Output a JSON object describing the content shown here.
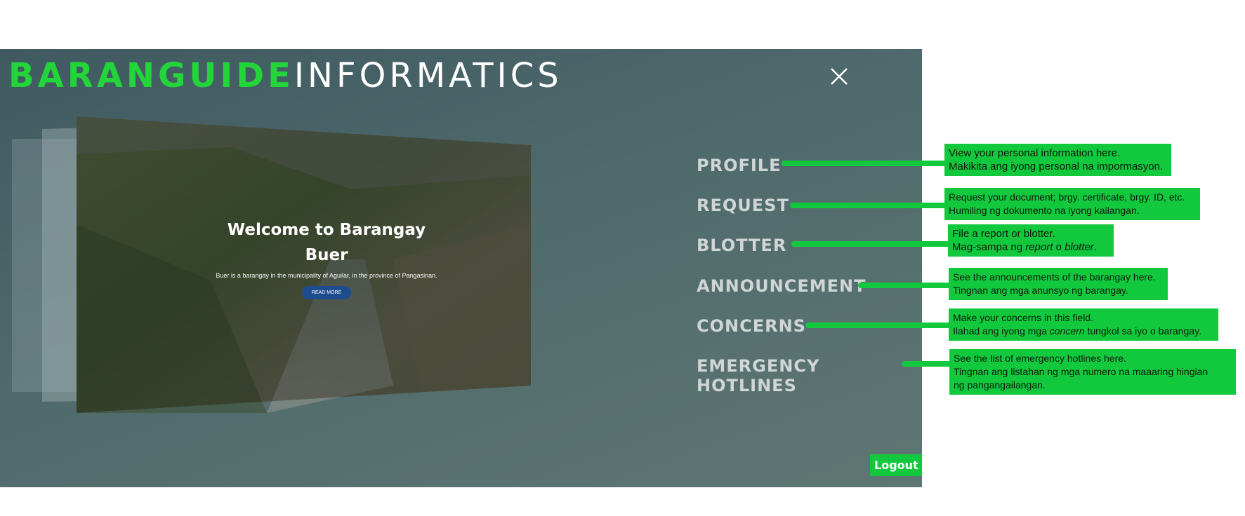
{
  "brand": {
    "part1": "BARANGUIDE",
    "part2": "INFORMATICS"
  },
  "hero": {
    "title_line1": "Welcome to Barangay",
    "title_line2": "Buer",
    "subtitle": "Buer is a barangay in the municipality of Aguilar, in the province of Pangasinan.",
    "button": "READ MORE"
  },
  "menu": [
    {
      "label": "PROFILE",
      "note_line1": "View your personal information here.",
      "note_line2": "Makikita ang iyong personal na impormasyon."
    },
    {
      "label": "REQUEST",
      "note_line1": "Request your document; brgy. certificate, brgy. ID, etc.",
      "note_line2": "Humiling ng dokumento na iyong kailangan."
    },
    {
      "label": "BLOTTER",
      "note_line1": "File a report or blotter.",
      "note_line2_a": "Mag-sampa ng ",
      "note_line2_em1": "report",
      "note_line2_b": " o ",
      "note_line2_em2": "blotter",
      "note_line2_c": "."
    },
    {
      "label": "ANNOUNCEMENT",
      "note_line1": "See the announcements of the barangay here.",
      "note_line2": "Tingnan ang mga anunsyo ng barangay."
    },
    {
      "label": "CONCERNS",
      "note_line1": "Make your concerns in this field.",
      "note_line2_a": "Ilahad ang iyong mga ",
      "note_line2_em": "concern",
      "note_line2_b": " tungkol sa iyo o barangay."
    },
    {
      "label": "EMERGENCY HOTLINES",
      "note_line1": "See the list of emergency hotlines here.",
      "note_line2": "Tingnan ang listahan ng mga numero na maaaring hingian",
      "note_line3": "ng pangangailangan."
    }
  ],
  "logout": "Logout",
  "colors": {
    "accent": "#12c93e",
    "brand_green": "#22d63a",
    "panel": "#4f6a6c"
  },
  "icons": {
    "close": "close-icon"
  }
}
